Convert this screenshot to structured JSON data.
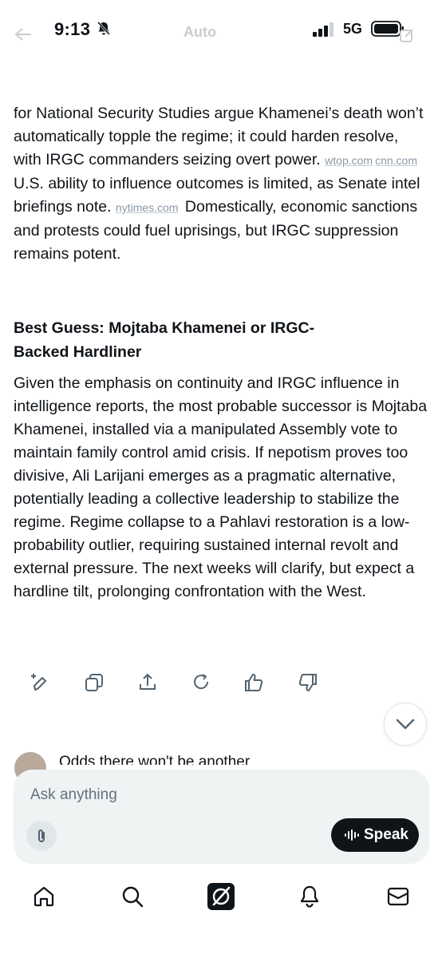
{
  "status_bar": {
    "time": "9:13",
    "network": "5G"
  },
  "header": {
    "mode_label": "Auto"
  },
  "article": {
    "para1_lead": "for National Security Studies argue Khamenei’s death won’t automatically topple the regime; it could harden resolve, with IRGC commanders seizing overt power.",
    "para1_src1": "wtop.com",
    "para1_src2": "cnn.com",
    "para1_mid": "U.S. ability to influence outcomes is limited, as Senate intel briefings note.",
    "para1_src3": "nytimes.com",
    "para1_tail": "Domestically, economic sanctions and protests could fuel uprisings, but IRGC suppression remains potent.",
    "heading": "Best Guess: Mojtaba Khamenei or IRGC-Backed Hardliner",
    "para2": "Given the emphasis on continuity and IRGC influence in intelligence reports, the most probable successor is Mojtaba Khamenei, installed via a manipulated Assembly vote to maintain family control amid crisis. If nepotism proves too divisive, Ali Larijani emerges as a pragmatic alternative, potentially leading a collective leadership to stabilize the regime. Regime collapse to a Pahlavi restoration is a low-probability outlier, requiring sustained internal revolt and external pressure. The next weeks will clarify, but expect a hardline tilt, prolonging confrontation with the West."
  },
  "peek": {
    "text": "Odds there won't be another"
  },
  "composer": {
    "placeholder": "Ask anything",
    "value": "",
    "speak_label": "Speak"
  },
  "icons": {
    "actions": [
      "edit-sparkle-icon",
      "copy-icon",
      "share-icon",
      "regenerate-icon",
      "thumbs-up-icon",
      "thumbs-down-icon"
    ],
    "tabs": [
      "home-icon",
      "search-icon",
      "grok-icon",
      "bell-icon",
      "mail-icon"
    ]
  }
}
